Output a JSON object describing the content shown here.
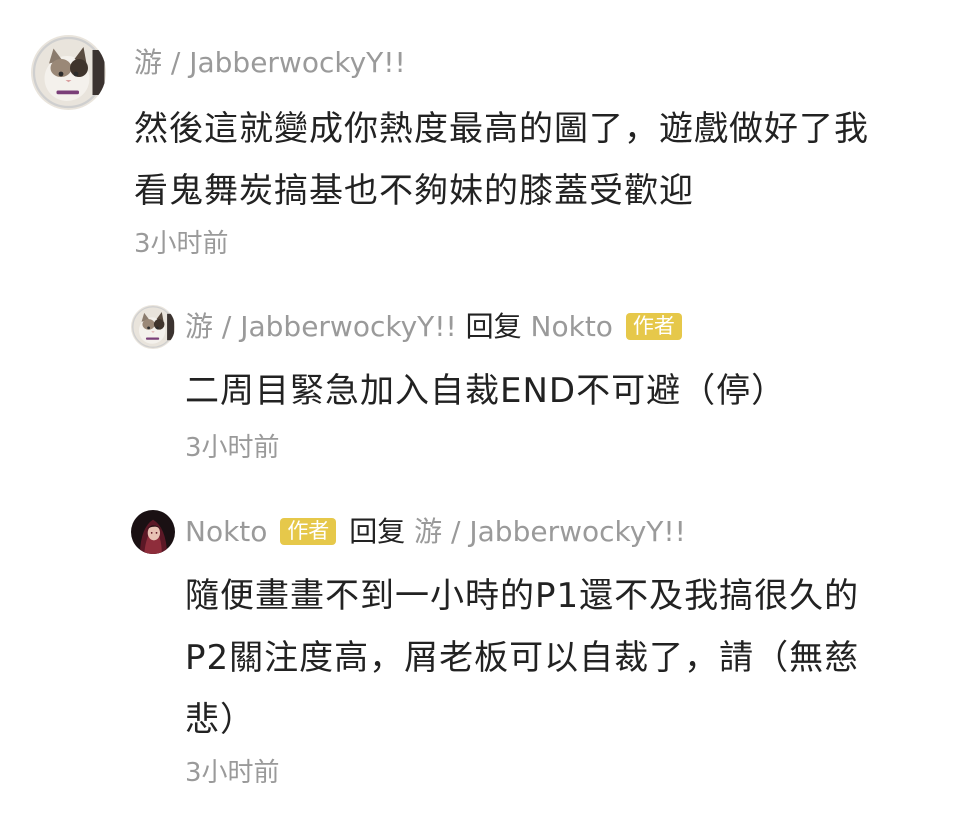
{
  "comments": [
    {
      "username": "游 / JabberwockyY!!",
      "text_lines": [
        "然後這就變成你熱度最高的圖了，遊戲做好了我",
        "看鬼舞炭搞基也不夠妹的膝蓋受歡迎"
      ],
      "time": "3小时前",
      "avatar_icon": "cat-avatar-icon"
    },
    {
      "username": "游 / JabberwockyY!!",
      "reply_word": "回复",
      "reply_to": "Nokto",
      "reply_to_badge": "作者",
      "text_lines": [
        "二周目緊急加入自裁END不可避（停）"
      ],
      "time": "3小时前",
      "avatar_icon": "cat-avatar-icon"
    },
    {
      "username": "Nokto",
      "username_badge": "作者",
      "reply_word": "回复",
      "reply_to": "游 / JabberwockyY!!",
      "text_lines": [
        "隨便畫畫不到一小時的P1還不及我搞很久的",
        "P2關注度高，屑老板可以自裁了，請（無慈",
        "悲）"
      ],
      "time": "3小时前",
      "avatar_icon": "character-avatar-icon"
    }
  ],
  "colors": {
    "meta_gray": "#9a9a9a",
    "text": "#222222",
    "author_badge": "#e6c84a"
  }
}
